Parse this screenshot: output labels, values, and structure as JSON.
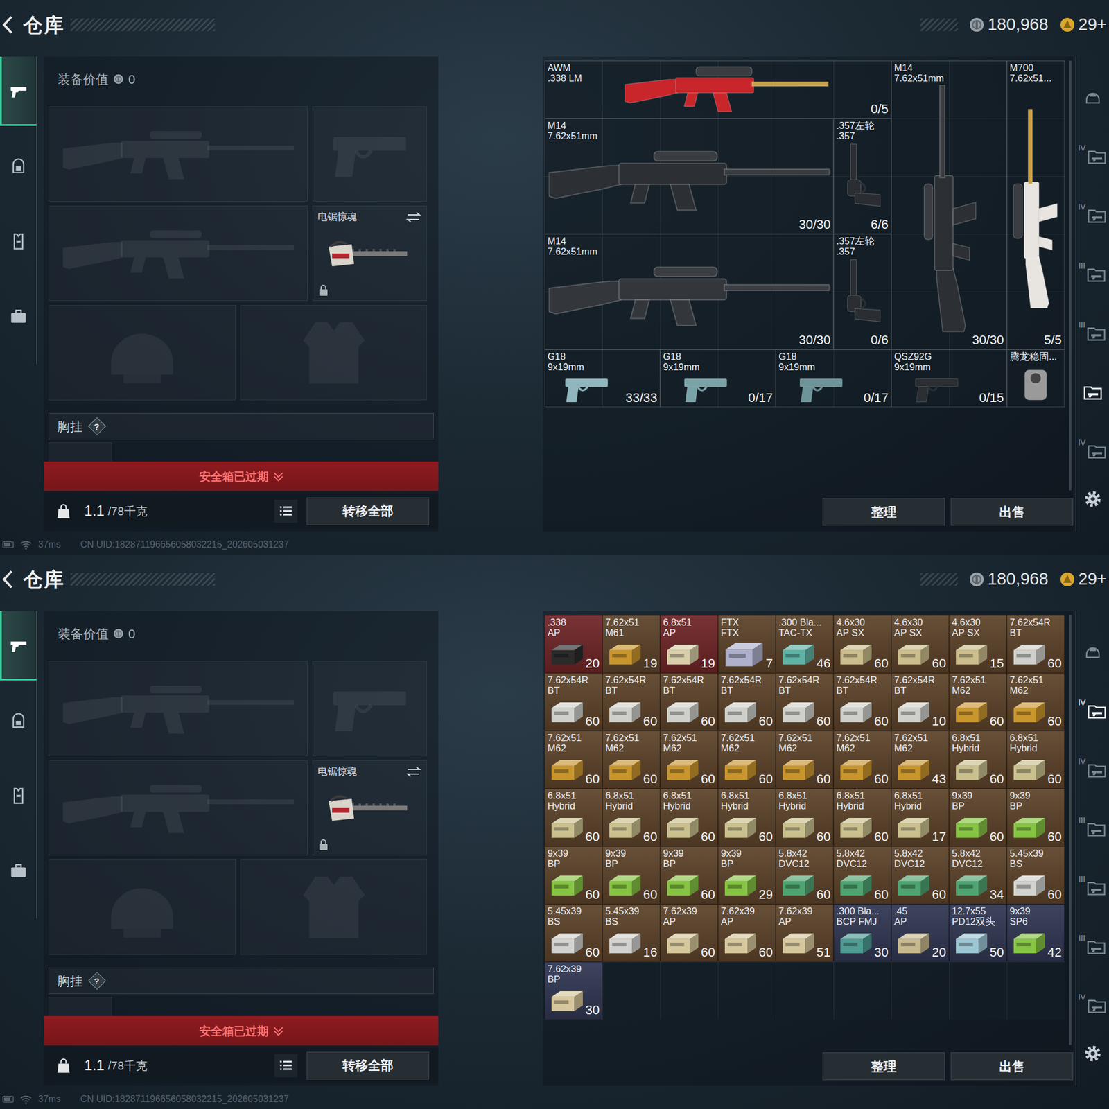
{
  "screens": [
    {
      "header": {
        "title": "仓库",
        "currency": [
          {
            "kind": "silver",
            "amount": "180,968"
          },
          {
            "kind": "gold",
            "amount": "29+"
          }
        ]
      },
      "sidebar": [
        {
          "selected": true
        },
        {
          "selected": false
        },
        {
          "selected": false
        },
        {
          "selected": false
        }
      ],
      "equipment": {
        "value_label": "装备价值",
        "value": "0",
        "melee": {
          "name": "电锯惊魂",
          "locked": true
        },
        "chest_rig": {
          "label": "胸挂",
          "help": "?"
        },
        "safebox": "安全箱已过期",
        "weight": {
          "current": "1.1",
          "max": "/78千克"
        },
        "transfer": "转移全部"
      },
      "storage": {
        "items": [
          {
            "kind": "sniper",
            "name": "AWM",
            "detail": ".338 LM",
            "count": "0/5",
            "color": "#c8262b"
          },
          {
            "kind": "rifle",
            "name": "M14",
            "detail": "7.62x51mm",
            "count": "30/30",
            "color": "#2c2f33"
          },
          {
            "kind": "sniper",
            "name": "M700",
            "detail": "7.62x51...",
            "count": "5/5",
            "color": "#e8e4e0"
          },
          {
            "kind": "rifle",
            "name": "M14",
            "detail": "7.62x51mm",
            "count": "30/30",
            "color": "#2c2f33"
          },
          {
            "kind": "revolver",
            "name": ".357左轮",
            "detail": ".357",
            "count": "6/6",
            "color": "#2a2d31"
          },
          {
            "kind": "rifle",
            "name": "M14",
            "detail": "7.62x51mm",
            "count": "30/30",
            "color": "#33373c"
          },
          {
            "kind": "revolver",
            "name": ".357左轮",
            "detail": ".357",
            "count": "0/6",
            "color": "#2a2d31"
          },
          {
            "kind": "pistol",
            "name": "G18",
            "detail": "9x19mm",
            "count": "33/33",
            "color": "#8fb7bd"
          },
          {
            "kind": "pistol",
            "name": "G18",
            "detail": "9x19mm",
            "count": "0/17",
            "color": "#7aa3a8"
          },
          {
            "kind": "pistol",
            "name": "G18",
            "detail": "9x19mm",
            "count": "0/17",
            "color": "#6c9499"
          },
          {
            "kind": "pistol",
            "name": "QSZ92G",
            "detail": "9x19mm",
            "count": "0/15",
            "color": "#2b2e32"
          },
          {
            "kind": "attachment",
            "name": "腾龙稳固...",
            "color": "#9a9a9a"
          }
        ],
        "buttons": [
          "整理",
          "出售"
        ]
      },
      "tabs": [
        {
          "selected": false
        },
        {
          "label": "IV",
          "selected": false
        },
        {
          "label": "IV",
          "selected": false
        },
        {
          "label": "III",
          "selected": false
        },
        {
          "label": "III",
          "selected": false
        },
        {
          "selected": true
        },
        {
          "label": "IV",
          "selected": false
        }
      ],
      "status_bar": {
        "ping": "37ms",
        "uid": "CN UID:182871196656058032215_202605031237"
      }
    },
    {
      "header": {
        "title": "仓库",
        "currency": [
          {
            "kind": "silver",
            "amount": "180,968"
          },
          {
            "kind": "gold",
            "amount": "29+"
          }
        ]
      },
      "sidebar": [
        {
          "selected": true
        },
        {
          "selected": false
        },
        {
          "selected": false
        },
        {
          "selected": false
        }
      ],
      "equipment": {
        "value_label": "装备价值",
        "value": "0",
        "melee": {
          "name": "电锯惊魂",
          "locked": true
        },
        "chest_rig": {
          "label": "胸挂",
          "help": "?"
        },
        "safebox": "安全箱已过期",
        "weight": {
          "current": "1.1",
          "max": "/78千克"
        },
        "transfer": "转移全部"
      },
      "storage": {
        "items": [
          {
            "kind": "ammo",
            "name": ".338",
            "detail": "AP",
            "count": "20",
            "color": "#6e2426",
            "box_color": "#2b2b2b"
          },
          {
            "kind": "ammo",
            "name": "7.62x51",
            "detail": "M61",
            "count": "19",
            "color": "#5c4229",
            "box_color": "#c9962e"
          },
          {
            "kind": "ammo",
            "name": "6.8x51",
            "detail": "AP",
            "count": "19",
            "color": "#6e2426",
            "box_color": "#d8cfaa"
          },
          {
            "kind": "ammo",
            "name": "FTX",
            "detail": "FTX",
            "count": "7",
            "color": "#5c4229",
            "box_color": "#aeb0cc"
          },
          {
            "kind": "ammo",
            "name": ".300 Bla...",
            "detail": "TAC-TX",
            "count": "46",
            "color": "#5c4229",
            "box_color": "#5fb3a6"
          },
          {
            "kind": "ammo",
            "name": "4.6x30",
            "detail": "AP SX",
            "count": "60",
            "color": "#5c4229",
            "box_color": "#cbbd8c"
          },
          {
            "kind": "ammo",
            "name": "4.6x30",
            "detail": "AP SX",
            "count": "60",
            "color": "#5c4229",
            "box_color": "#cbbd8c"
          },
          {
            "kind": "ammo",
            "name": "4.6x30",
            "detail": "AP SX",
            "count": "15",
            "color": "#5c4229",
            "box_color": "#cbbd8c"
          },
          {
            "kind": "ammo",
            "name": "7.62x54R",
            "detail": "BT",
            "count": "60",
            "color": "#5c4229",
            "box_color": "#cfd0cb"
          },
          {
            "kind": "ammo",
            "name": "7.62x54R",
            "detail": "BT",
            "count": "60",
            "color": "#5c4229",
            "box_color": "#cfd0cb"
          },
          {
            "kind": "ammo",
            "name": "7.62x54R",
            "detail": "BT",
            "count": "60",
            "color": "#5c4229",
            "box_color": "#cfd0cb"
          },
          {
            "kind": "ammo",
            "name": "7.62x54R",
            "detail": "BT",
            "count": "60",
            "color": "#5c4229",
            "box_color": "#cfd0cb"
          },
          {
            "kind": "ammo",
            "name": "7.62x54R",
            "detail": "BT",
            "count": "60",
            "color": "#5c4229",
            "box_color": "#cfd0cb"
          },
          {
            "kind": "ammo",
            "name": "7.62x54R",
            "detail": "BT",
            "count": "60",
            "color": "#5c4229",
            "box_color": "#cfd0cb"
          },
          {
            "kind": "ammo",
            "name": "7.62x54R",
            "detail": "BT",
            "count": "60",
            "color": "#5c4229",
            "box_color": "#cfd0cb"
          },
          {
            "kind": "ammo",
            "name": "7.62x54R",
            "detail": "BT",
            "count": "10",
            "color": "#5c4229",
            "box_color": "#cfd0cb"
          },
          {
            "kind": "ammo",
            "name": "7.62x51",
            "detail": "M62",
            "count": "60",
            "color": "#5c4229",
            "box_color": "#c9962e"
          },
          {
            "kind": "ammo",
            "name": "7.62x51",
            "detail": "M62",
            "count": "60",
            "color": "#5c4229",
            "box_color": "#c9962e"
          },
          {
            "kind": "ammo",
            "name": "7.62x51",
            "detail": "M62",
            "count": "60",
            "color": "#5c4229",
            "box_color": "#c9962e"
          },
          {
            "kind": "ammo",
            "name": "7.62x51",
            "detail": "M62",
            "count": "60",
            "color": "#5c4229",
            "box_color": "#c9962e"
          },
          {
            "kind": "ammo",
            "name": "7.62x51",
            "detail": "M62",
            "count": "60",
            "color": "#5c4229",
            "box_color": "#c9962e"
          },
          {
            "kind": "ammo",
            "name": "7.62x51",
            "detail": "M62",
            "count": "60",
            "color": "#5c4229",
            "box_color": "#c9962e"
          },
          {
            "kind": "ammo",
            "name": "7.62x51",
            "detail": "M62",
            "count": "60",
            "color": "#5c4229",
            "box_color": "#c9962e"
          },
          {
            "kind": "ammo",
            "name": "7.62x51",
            "detail": "M62",
            "count": "60",
            "color": "#5c4229",
            "box_color": "#c9962e"
          },
          {
            "kind": "ammo",
            "name": "7.62x51",
            "detail": "M62",
            "count": "43",
            "color": "#5c4229",
            "box_color": "#c9962e"
          },
          {
            "kind": "ammo",
            "name": "6.8x51",
            "detail": "Hybrid",
            "count": "60",
            "color": "#5c4229",
            "box_color": "#c9c08e"
          },
          {
            "kind": "ammo",
            "name": "6.8x51",
            "detail": "Hybrid",
            "count": "60",
            "color": "#5c4229",
            "box_color": "#c9c08e"
          },
          {
            "kind": "ammo",
            "name": "6.8x51",
            "detail": "Hybrid",
            "count": "60",
            "color": "#5c4229",
            "box_color": "#c9c08e"
          },
          {
            "kind": "ammo",
            "name": "6.8x51",
            "detail": "Hybrid",
            "count": "60",
            "color": "#5c4229",
            "box_color": "#c9c08e"
          },
          {
            "kind": "ammo",
            "name": "6.8x51",
            "detail": "Hybrid",
            "count": "60",
            "color": "#5c4229",
            "box_color": "#c9c08e"
          },
          {
            "kind": "ammo",
            "name": "6.8x51",
            "detail": "Hybrid",
            "count": "60",
            "color": "#5c4229",
            "box_color": "#c9c08e"
          },
          {
            "kind": "ammo",
            "name": "6.8x51",
            "detail": "Hybrid",
            "count": "60",
            "color": "#5c4229",
            "box_color": "#c9c08e"
          },
          {
            "kind": "ammo",
            "name": "6.8x51",
            "detail": "Hybrid",
            "count": "60",
            "color": "#5c4229",
            "box_color": "#c9c08e"
          },
          {
            "kind": "ammo",
            "name": "6.8x51",
            "detail": "Hybrid",
            "count": "17",
            "color": "#5c4229",
            "box_color": "#c9c08e"
          },
          {
            "kind": "ammo",
            "name": "9x39",
            "detail": "BP",
            "count": "60",
            "color": "#5c4229",
            "box_color": "#86c444"
          },
          {
            "kind": "ammo",
            "name": "9x39",
            "detail": "BP",
            "count": "60",
            "color": "#5c4229",
            "box_color": "#86c444"
          },
          {
            "kind": "ammo",
            "name": "9x39",
            "detail": "BP",
            "count": "60",
            "color": "#5c4229",
            "box_color": "#86c444"
          },
          {
            "kind": "ammo",
            "name": "9x39",
            "detail": "BP",
            "count": "60",
            "color": "#5c4229",
            "box_color": "#86c444"
          },
          {
            "kind": "ammo",
            "name": "9x39",
            "detail": "BP",
            "count": "60",
            "color": "#5c4229",
            "box_color": "#86c444"
          },
          {
            "kind": "ammo",
            "name": "9x39",
            "detail": "BP",
            "count": "29",
            "color": "#5c4229",
            "box_color": "#86c444"
          },
          {
            "kind": "ammo",
            "name": "5.8x42",
            "detail": "DVC12",
            "count": "60",
            "color": "#5c4229",
            "box_color": "#4fa472"
          },
          {
            "kind": "ammo",
            "name": "5.8x42",
            "detail": "DVC12",
            "count": "60",
            "color": "#5c4229",
            "box_color": "#4fa472"
          },
          {
            "kind": "ammo",
            "name": "5.8x42",
            "detail": "DVC12",
            "count": "60",
            "color": "#5c4229",
            "box_color": "#4fa472"
          },
          {
            "kind": "ammo",
            "name": "5.8x42",
            "detail": "DVC12",
            "count": "34",
            "color": "#5c4229",
            "box_color": "#4fa472"
          },
          {
            "kind": "ammo",
            "name": "5.45x39",
            "detail": "BS",
            "count": "60",
            "color": "#5c4229",
            "box_color": "#d2d3d0"
          },
          {
            "kind": "ammo",
            "name": "5.45x39",
            "detail": "BS",
            "count": "60",
            "color": "#5c4229",
            "box_color": "#d2d3d0"
          },
          {
            "kind": "ammo",
            "name": "5.45x39",
            "detail": "BS",
            "count": "16",
            "color": "#5c4229",
            "box_color": "#d2d3d0"
          },
          {
            "kind": "ammo",
            "name": "7.62x39",
            "detail": "AP",
            "count": "60",
            "color": "#5c4229",
            "box_color": "#d6c89c"
          },
          {
            "kind": "ammo",
            "name": "7.62x39",
            "detail": "AP",
            "count": "60",
            "color": "#5c4229",
            "box_color": "#d6c89c"
          },
          {
            "kind": "ammo",
            "name": "7.62x39",
            "detail": "AP",
            "count": "51",
            "color": "#5c4229",
            "box_color": "#d6c89c"
          },
          {
            "kind": "ammo",
            "name": ".300 Bla...",
            "detail": "BCP FMJ",
            "count": "30",
            "color": "#303652",
            "box_color": "#4e9c93"
          },
          {
            "kind": "ammo",
            "name": ".45",
            "detail": "AP",
            "count": "20",
            "color": "#303652",
            "box_color": "#c8b88e"
          },
          {
            "kind": "ammo",
            "name": "12.7x55",
            "detail": "PD12双头",
            "count": "50",
            "color": "#303652",
            "box_color": "#9cc6d3"
          },
          {
            "kind": "ammo",
            "name": "9x39",
            "detail": "SP6",
            "count": "42",
            "color": "#303652",
            "box_color": "#86c444"
          },
          {
            "kind": "ammo",
            "name": "7.62x39",
            "detail": "BP",
            "count": "30",
            "color": "#303652",
            "box_color": "#d6c89c"
          }
        ],
        "buttons": [
          "整理",
          "出售"
        ]
      },
      "tabs": [
        {
          "selected": false
        },
        {
          "label": "IV",
          "selected": true
        },
        {
          "label": "IV",
          "selected": false
        },
        {
          "label": "III",
          "selected": false
        },
        {
          "label": "III",
          "selected": false
        },
        {
          "label": "III",
          "selected": false
        },
        {
          "label": "IV",
          "selected": false
        }
      ],
      "status_bar": {
        "ping": "37ms",
        "uid": "CN UID:182871196656058032215_202605031237"
      }
    }
  ]
}
